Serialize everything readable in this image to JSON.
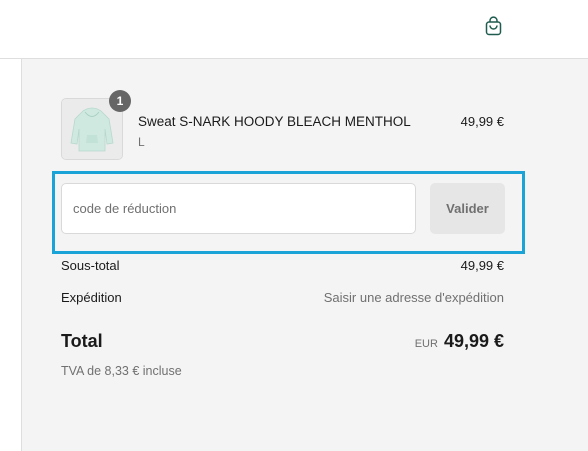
{
  "header": {
    "cart_icon": "shopping-bag-icon",
    "accent_color": "#1f5c4f"
  },
  "product": {
    "name": "Sweat S-NARK HOODY BLEACH MENTHOL",
    "variant": "L",
    "price": "49,99 €",
    "quantity": "1",
    "image": "mint-hoodie-thumbnail"
  },
  "discount": {
    "placeholder": "code de réduction",
    "value": "",
    "apply_label": "Valider",
    "highlight_color": "#1aa3d6"
  },
  "totals": {
    "subtotal_label": "Sous-total",
    "subtotal_value": "49,99 €",
    "shipping_label": "Expédition",
    "shipping_value": "Saisir une adresse d'expédition",
    "total_label": "Total",
    "currency": "EUR",
    "total_value": "49,99 €",
    "tax_note": "TVA de 8,33 € incluse"
  }
}
